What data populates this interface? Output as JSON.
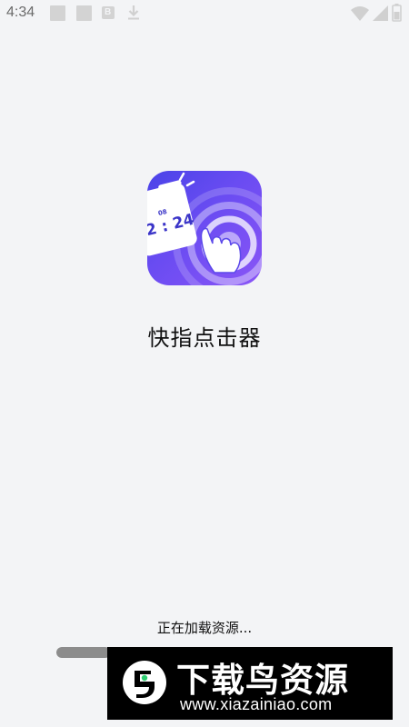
{
  "status_bar": {
    "time": "4:34",
    "notification_badge": "B",
    "icons": [
      "square-icon",
      "square-icon",
      "b-badge-icon",
      "download-icon",
      "wifi-icon",
      "signal-icon",
      "battery-icon"
    ]
  },
  "app": {
    "name": "快指点击器",
    "icon_time": "2 : 24",
    "icon_time_small": "08"
  },
  "loading": {
    "text": "正在加载资源...",
    "progress": 0.18
  },
  "watermark": {
    "title": "下载鸟资源",
    "url": "www.xiazainiao.com"
  },
  "colors": {
    "background": "#f3f4f6",
    "icon_gradient_start": "#4a43e8",
    "icon_gradient_end": "#8a55f6",
    "progress_track": "#c9c9c9",
    "progress_fill": "#8c8c8c"
  }
}
